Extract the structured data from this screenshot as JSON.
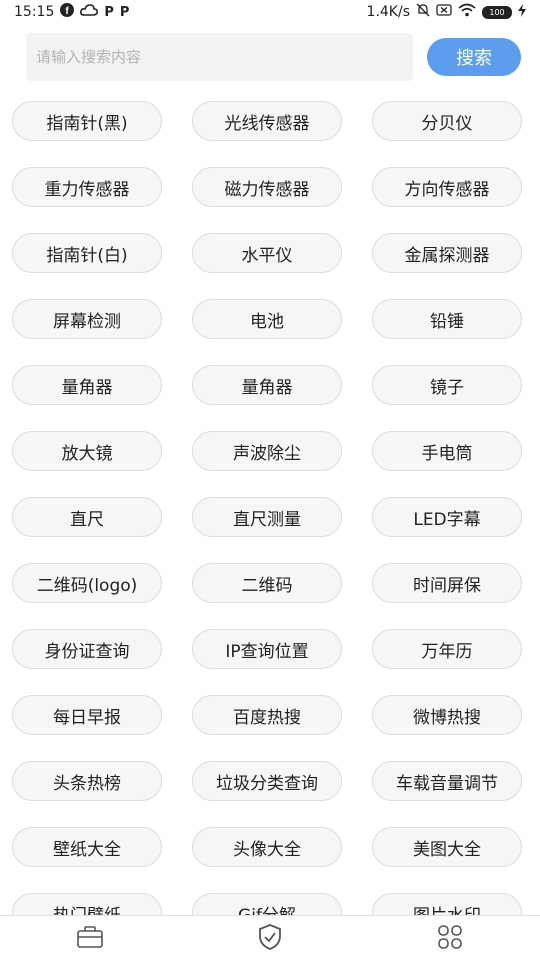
{
  "status_bar": {
    "time": "15:15",
    "notif_icons": [
      "P",
      "P"
    ],
    "network_speed": "1.4K/s",
    "battery": "100"
  },
  "search": {
    "placeholder": "请输入搜索内容",
    "value": "",
    "button_label": "搜索"
  },
  "tools": [
    "指南针(黑)",
    "光线传感器",
    "分贝仪",
    "重力传感器",
    "磁力传感器",
    "方向传感器",
    "指南针(白)",
    "水平仪",
    "金属探测器",
    "屏幕检测",
    "电池",
    "铅锤",
    "量角器",
    "量角器",
    "镜子",
    "放大镜",
    "声波除尘",
    "手电筒",
    "直尺",
    "直尺测量",
    "LED字幕",
    "二维码(logo)",
    "二维码",
    "时间屏保",
    "身份证查询",
    "IP查询位置",
    "万年历",
    "每日早报",
    "百度热搜",
    "微博热搜",
    "头条热榜",
    "垃圾分类查询",
    "车载音量调节",
    "壁纸大全",
    "头像大全",
    "美图大全",
    "热门壁纸",
    "Gif分解",
    "图片水印"
  ],
  "bottom_nav": {
    "icons": [
      "toolbox-icon",
      "shield-check-icon",
      "grid-icon"
    ]
  },
  "colors": {
    "accent": "#5c9ded",
    "pill_bg": "#f6f6f6",
    "pill_border": "#dcdcdc",
    "search_bg": "#f3f3f5"
  }
}
